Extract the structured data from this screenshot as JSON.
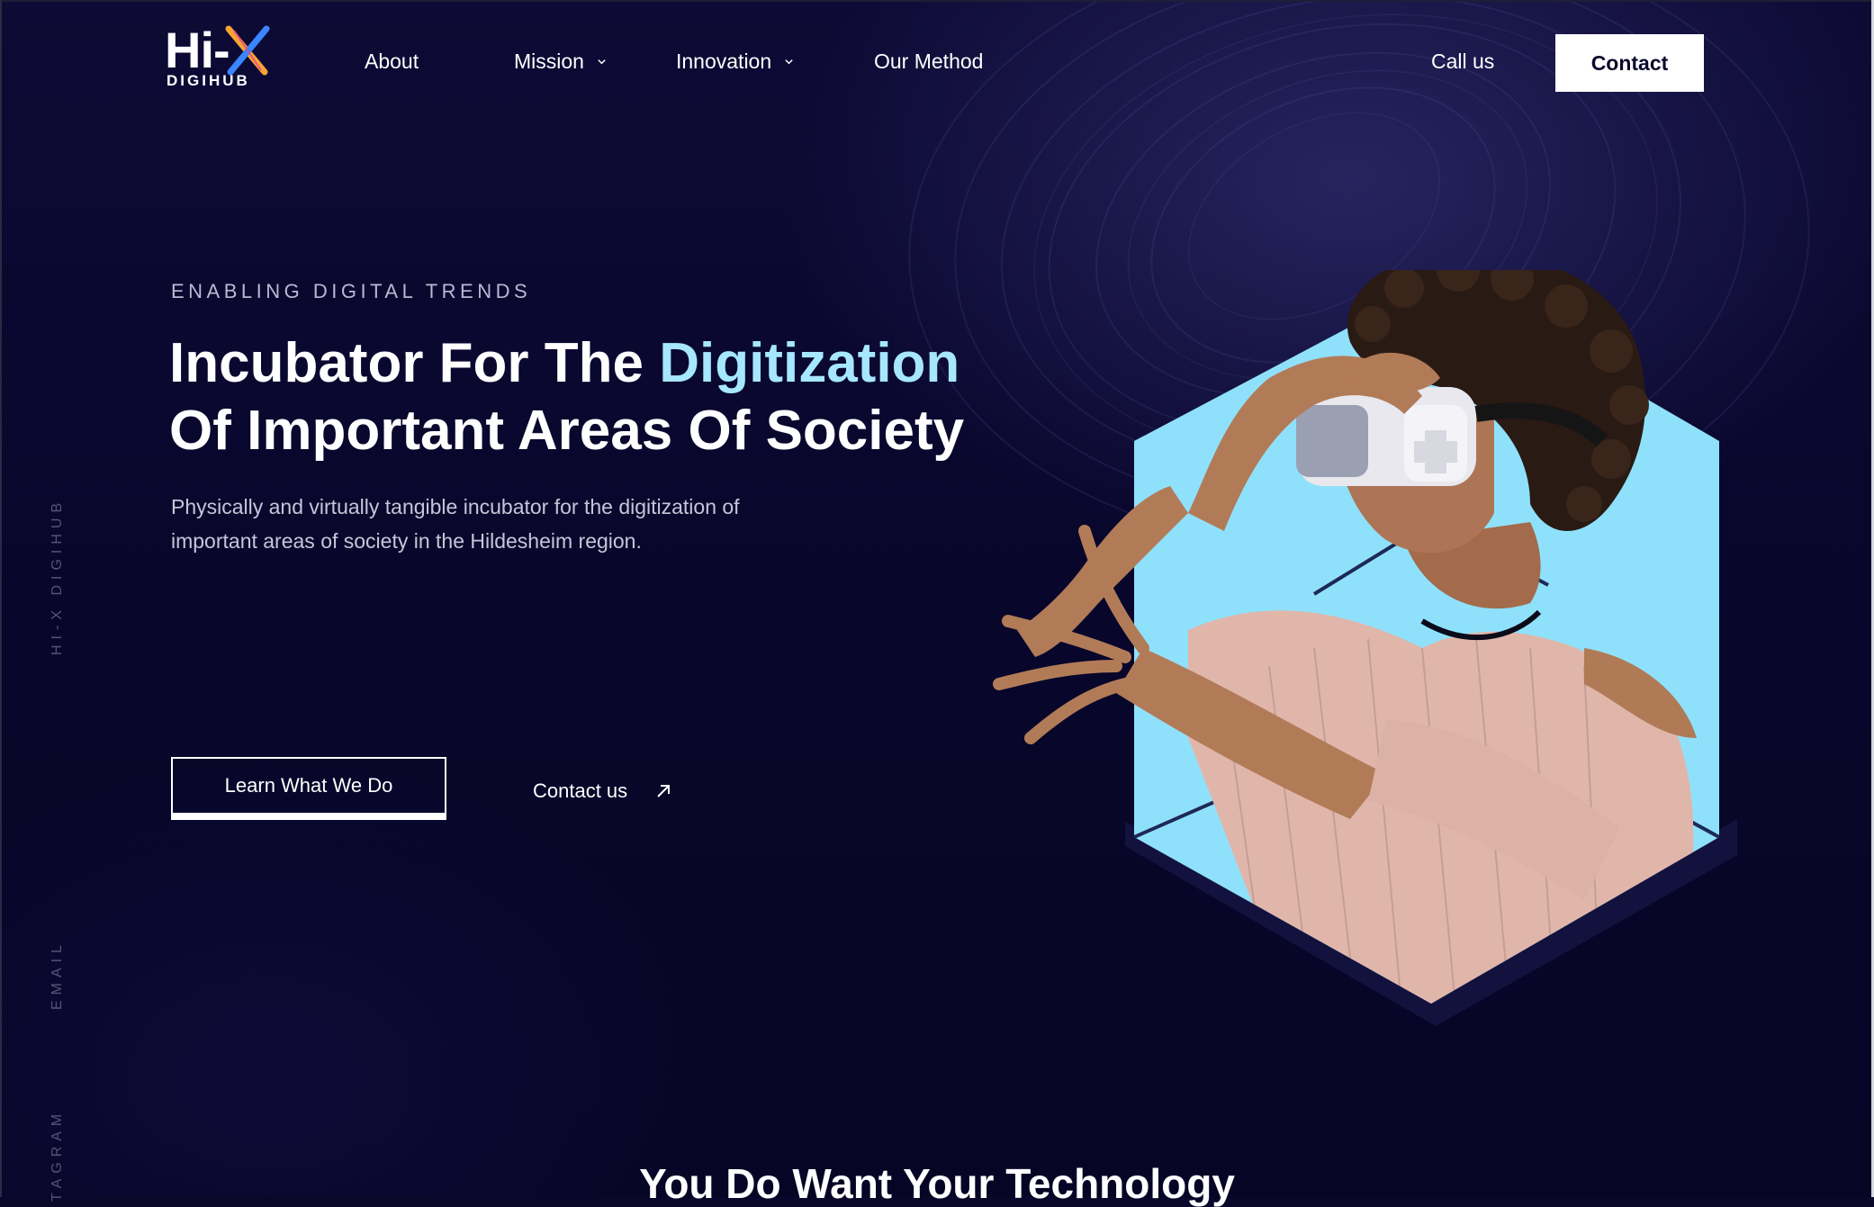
{
  "brand": {
    "logo_main": "Hi-X",
    "logo_sub": "DIGIHUB"
  },
  "nav": {
    "items": [
      {
        "label": "About",
        "has_dropdown": false
      },
      {
        "label": "Mission",
        "has_dropdown": true
      },
      {
        "label": "Innovation",
        "has_dropdown": true
      },
      {
        "label": "Our Method",
        "has_dropdown": false
      }
    ],
    "call_label": "Call us",
    "contact_label": "Contact"
  },
  "side_rail": {
    "brand": "HI-X DIGIHUB",
    "email": "EMAIL",
    "instagram": "TAGRAM"
  },
  "hero": {
    "eyebrow": "ENABLING DIGITAL TRENDS",
    "headline_part1": "Incubator For The ",
    "headline_highlight": "Digitization",
    "headline_part2": "Of Important Areas Of Society",
    "description": "Physically and virtually tangible incubator for the digitization of important areas of society in the Hildesheim region.",
    "primary_cta": "Learn What We Do",
    "secondary_cta": "Contact us",
    "secondary_cta_icon": "arrow-up-right-icon"
  },
  "next_section": {
    "title": "You Do Want Your Technology"
  },
  "colors": {
    "background": "#09072a",
    "accent": "#a6e7ff",
    "hexagon_fill": "#8fe1fb",
    "text": "#ffffff",
    "muted": "#c6c6d8"
  }
}
